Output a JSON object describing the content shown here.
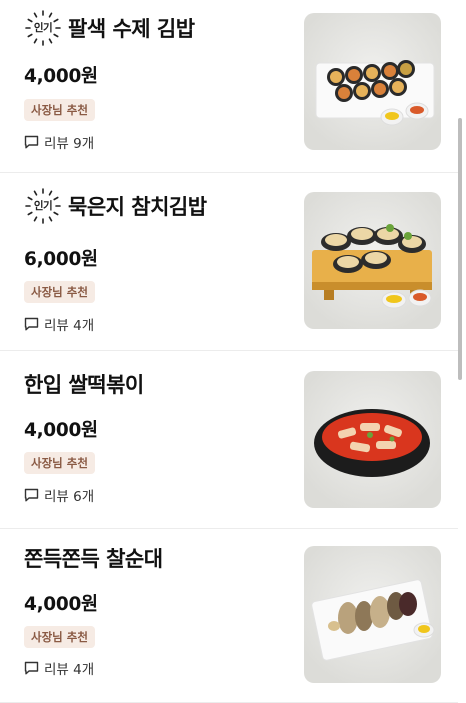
{
  "menu_items": [
    {
      "popular_badge": "인기",
      "name": "팔색 수제 김밥",
      "price": "4,000원",
      "recommendation": "사장님 추천",
      "reviews": "리뷰 9개",
      "image": "kimbap-platter"
    },
    {
      "popular_badge": "인기",
      "name": "묵은지 참치김밥",
      "price": "6,000원",
      "recommendation": "사장님 추천",
      "reviews": "리뷰 4개",
      "image": "tuna-kimbap-on-wooden-board"
    },
    {
      "popular_badge": "",
      "name": "한입 쌀떡볶이",
      "price": "4,000원",
      "recommendation": "사장님 추천",
      "reviews": "리뷰 6개",
      "image": "tteokbokki-bowl"
    },
    {
      "popular_badge": "",
      "name": "쫀득쫀득 찰순대",
      "price": "4,000원",
      "recommendation": "사장님 추천",
      "reviews": "리뷰 4개",
      "image": "sundae-plate"
    }
  ],
  "colors": {
    "recommendation_bg": "#f6ebe4",
    "recommendation_text": "#8a5a44"
  },
  "icons": {
    "review": "speech-bubble-icon",
    "popular": "starburst-badge-icon"
  }
}
